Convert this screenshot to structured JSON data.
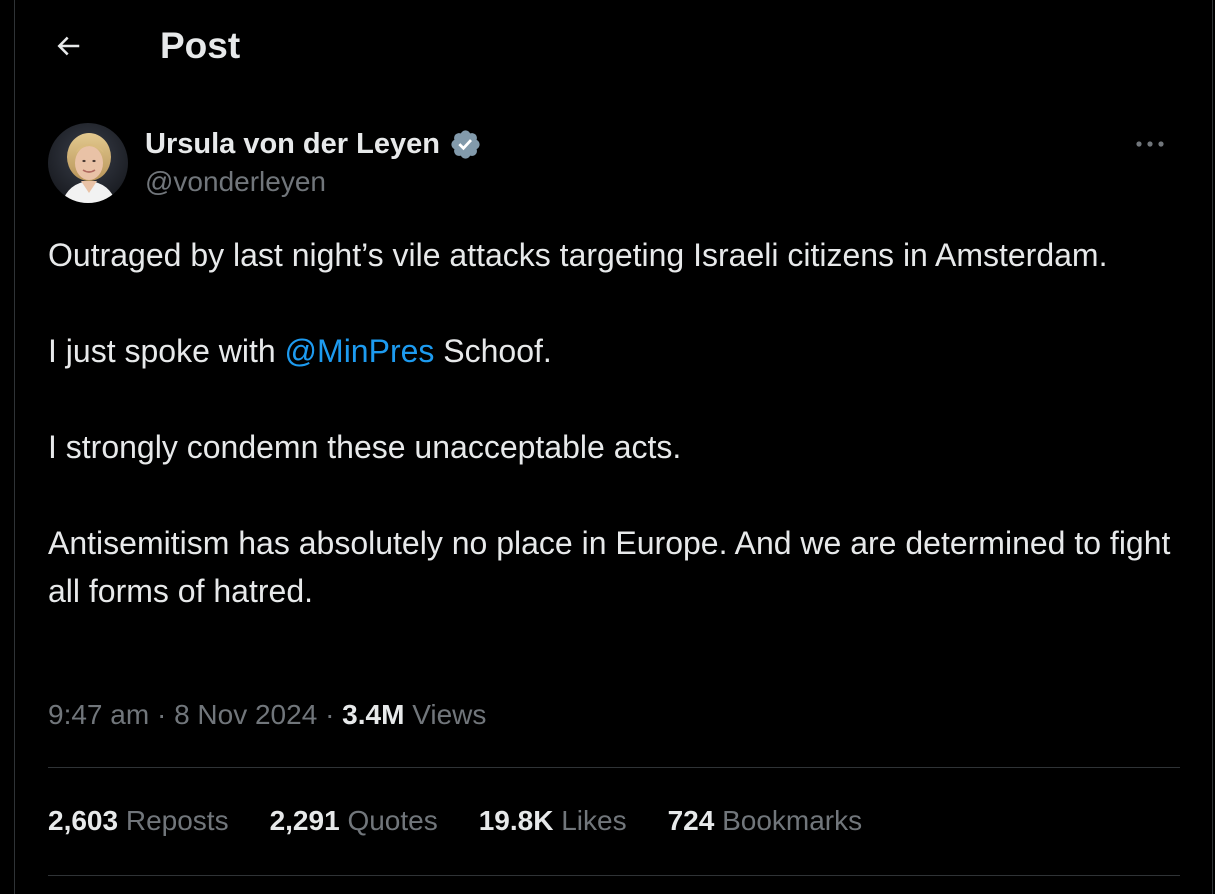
{
  "header": {
    "title": "Post",
    "back_icon": "arrow-left-icon"
  },
  "author": {
    "display_name": "Ursula von der Leyen",
    "handle": "@vonderleyen",
    "verified_icon": "verified-badge-icon",
    "verified_color": "#829aab"
  },
  "post": {
    "paragraph_1": "Outraged by last night’s vile attacks targeting Israeli citizens in Amsterdam.",
    "paragraph_2_before": "I just spoke with ",
    "paragraph_2_mention": "@MinPres",
    "paragraph_2_after": " Schoof.",
    "paragraph_3": "I strongly condemn these unacceptable acts.",
    "paragraph_4": "Antisemitism has absolutely no place in Europe. And we are determined to fight all forms of hatred."
  },
  "meta": {
    "time": "9:47 am",
    "separator": "·",
    "date": "8 Nov 2024",
    "views_count": "3.4M",
    "views_label": "Views"
  },
  "stats": {
    "reposts_count": "2,603",
    "reposts_label": "Reposts",
    "quotes_count": "2,291",
    "quotes_label": "Quotes",
    "likes_count": "19.8K",
    "likes_label": "Likes",
    "bookmarks_count": "724",
    "bookmarks_label": "Bookmarks"
  },
  "colors": {
    "background": "#000000",
    "text": "#e7e9ea",
    "secondary_text": "#71767b",
    "link": "#1d9bf0",
    "divider": "#2f3336"
  },
  "more_icon": "more-horizontal-icon"
}
